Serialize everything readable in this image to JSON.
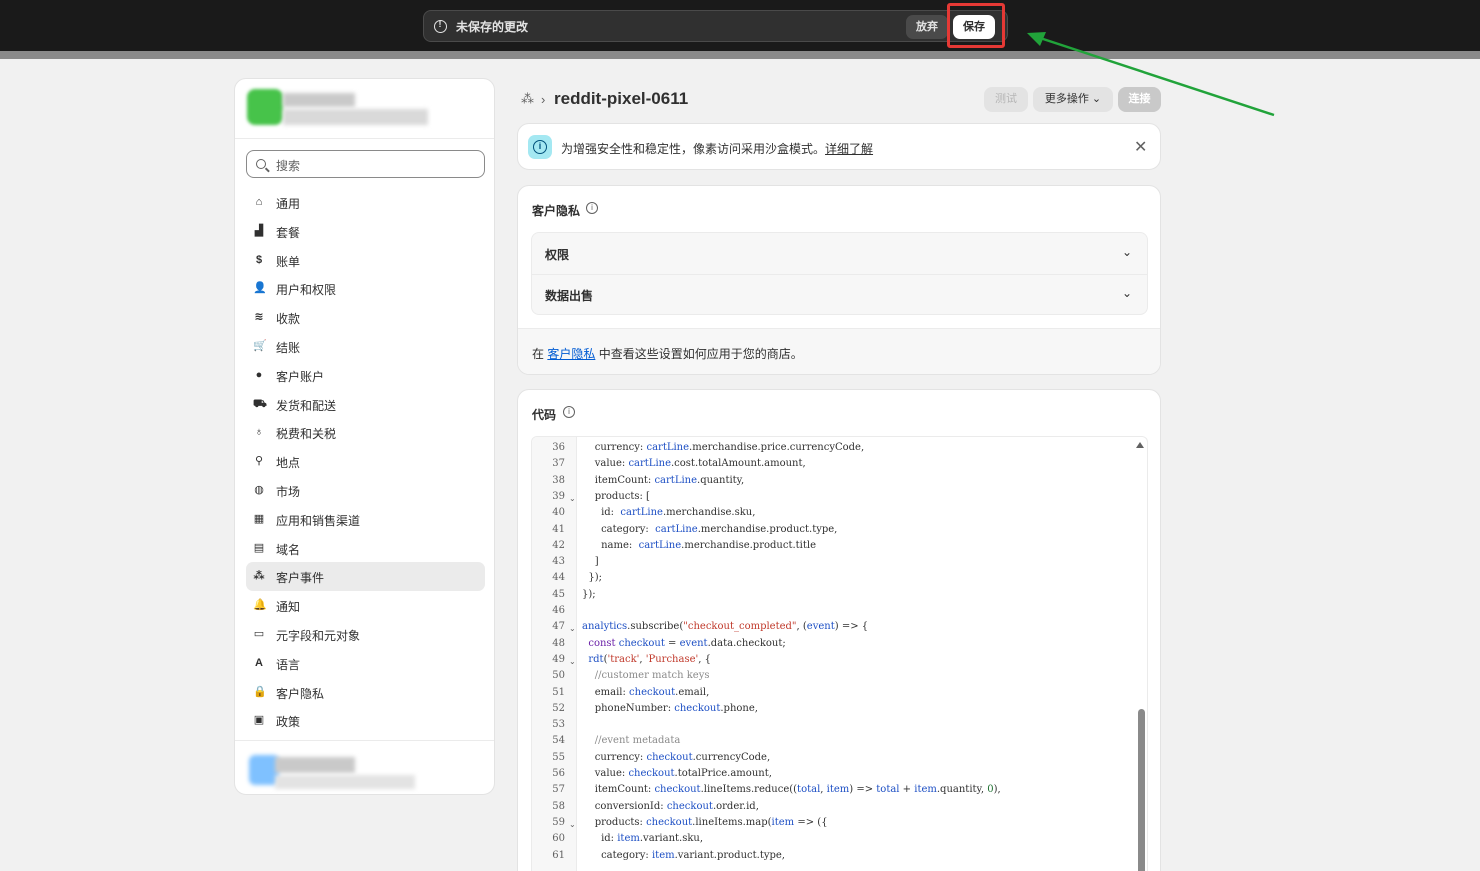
{
  "topbar": {
    "unsaved_text": "未保存的更改",
    "discard_label": "放弃",
    "save_label": "保存"
  },
  "sidebar": {
    "search_placeholder": "搜索",
    "items": [
      {
        "label": "通用",
        "icon": "store-icon",
        "glyph": "⌂"
      },
      {
        "label": "套餐",
        "icon": "chart-icon",
        "glyph": "▟"
      },
      {
        "label": "账单",
        "icon": "bill-icon",
        "glyph": "$"
      },
      {
        "label": "用户和权限",
        "icon": "users-icon",
        "glyph": "👤"
      },
      {
        "label": "收款",
        "icon": "payment-icon",
        "glyph": "≋"
      },
      {
        "label": "结账",
        "icon": "cart-icon",
        "glyph": "🛒"
      },
      {
        "label": "客户账户",
        "icon": "person-icon",
        "glyph": "●"
      },
      {
        "label": "发货和配送",
        "icon": "truck-icon",
        "glyph": "⛟"
      },
      {
        "label": "税费和关税",
        "icon": "tax-icon",
        "glyph": "♁"
      },
      {
        "label": "地点",
        "icon": "location-icon",
        "glyph": "⚲"
      },
      {
        "label": "市场",
        "icon": "globe-icon",
        "glyph": "◍"
      },
      {
        "label": "应用和销售渠道",
        "icon": "apps-icon",
        "glyph": "▦"
      },
      {
        "label": "域名",
        "icon": "domain-icon",
        "glyph": "▤"
      },
      {
        "label": "客户事件",
        "icon": "events-icon",
        "glyph": "⁂",
        "active": true
      },
      {
        "label": "通知",
        "icon": "bell-icon",
        "glyph": "🔔"
      },
      {
        "label": "元字段和元对象",
        "icon": "metafields-icon",
        "glyph": "▭"
      },
      {
        "label": "语言",
        "icon": "language-icon",
        "glyph": "A"
      },
      {
        "label": "客户隐私",
        "icon": "lock-icon",
        "glyph": "🔒"
      },
      {
        "label": "政策",
        "icon": "policy-icon",
        "glyph": "▣"
      }
    ]
  },
  "header": {
    "breadcrumb_icon": "events-icon",
    "title": "reddit-pixel-0611",
    "test_label": "测试",
    "more_label": "更多操作",
    "connect_label": "连接"
  },
  "banner": {
    "text": "为增强安全性和稳定性，像素访问采用沙盒模式。",
    "link": "详细了解"
  },
  "privacy": {
    "title": "客户隐私",
    "rows": [
      "权限",
      "数据出售"
    ],
    "footer_prefix": "在",
    "footer_link": "客户隐私",
    "footer_suffix": "中查看这些设置如何应用于您的商店。"
  },
  "code": {
    "title": "代码",
    "lines": [
      {
        "n": "36",
        "fold": false,
        "html": "    currency: <span class=\"tk-var\">cartLine</span>.merchandise.price.currencyCode,"
      },
      {
        "n": "37",
        "fold": false,
        "html": "    value: <span class=\"tk-var\">cartLine</span>.cost.totalAmount.amount,"
      },
      {
        "n": "38",
        "fold": false,
        "html": "    itemCount: <span class=\"tk-var\">cartLine</span>.quantity,"
      },
      {
        "n": "39",
        "fold": true,
        "html": "    products: ["
      },
      {
        "n": "40",
        "fold": false,
        "html": "      id:  <span class=\"tk-var\">cartLine</span>.merchandise.sku,"
      },
      {
        "n": "41",
        "fold": false,
        "html": "      category:  <span class=\"tk-var\">cartLine</span>.merchandise.product.type,"
      },
      {
        "n": "42",
        "fold": false,
        "html": "      name:  <span class=\"tk-var\">cartLine</span>.merchandise.product.title"
      },
      {
        "n": "43",
        "fold": false,
        "html": "    ]"
      },
      {
        "n": "44",
        "fold": false,
        "html": "  });"
      },
      {
        "n": "45",
        "fold": false,
        "html": "});"
      },
      {
        "n": "46",
        "fold": false,
        "html": ""
      },
      {
        "n": "47",
        "fold": true,
        "html": "<span class=\"tk-var\">analytics</span>.subscribe(<span class=\"tk-str\">\"checkout_completed\"</span>, (<span class=\"tk-var\">event</span>) => {"
      },
      {
        "n": "48",
        "fold": false,
        "html": "  <span class=\"tk-kw\">const</span> <span class=\"tk-var\">checkout</span> = <span class=\"tk-var\">event</span>.data.checkout;"
      },
      {
        "n": "49",
        "fold": true,
        "html": "  <span class=\"tk-var\">rdt</span>(<span class=\"tk-str\">'track'</span>, <span class=\"tk-str\">'Purchase'</span>, {"
      },
      {
        "n": "50",
        "fold": false,
        "html": "    <span class=\"tk-cmt\">//customer match keys</span>"
      },
      {
        "n": "51",
        "fold": false,
        "html": "    email: <span class=\"tk-var\">checkout</span>.email,"
      },
      {
        "n": "52",
        "fold": false,
        "html": "    phoneNumber: <span class=\"tk-var\">checkout</span>.phone,"
      },
      {
        "n": "53",
        "fold": false,
        "html": ""
      },
      {
        "n": "54",
        "fold": false,
        "html": "    <span class=\"tk-cmt\">//event metadata</span>"
      },
      {
        "n": "55",
        "fold": false,
        "html": "    currency: <span class=\"tk-var\">checkout</span>.currencyCode,"
      },
      {
        "n": "56",
        "fold": false,
        "html": "    value: <span class=\"tk-var\">checkout</span>.totalPrice.amount,"
      },
      {
        "n": "57",
        "fold": false,
        "html": "    itemCount: <span class=\"tk-var\">checkout</span>.lineItems.reduce((<span class=\"tk-var\">total</span>, <span class=\"tk-var\">item</span>) => <span class=\"tk-var\">total</span> + <span class=\"tk-var\">item</span>.quantity, <span class=\"tk-num\">0</span>),"
      },
      {
        "n": "58",
        "fold": false,
        "html": "    conversionId: <span class=\"tk-var\">checkout</span>.order.id,"
      },
      {
        "n": "59",
        "fold": true,
        "html": "    products: <span class=\"tk-var\">checkout</span>.lineItems.map(<span class=\"tk-var\">item</span> => ({"
      },
      {
        "n": "60",
        "fold": false,
        "html": "      id: <span class=\"tk-var\">item</span>.variant.sku,"
      },
      {
        "n": "61",
        "fold": false,
        "html": "      category: <span class=\"tk-var\">item</span>.variant.product.type,"
      }
    ]
  },
  "colors": {
    "topbar_bg": "#1a1a1a",
    "highlight": "#e53935",
    "arrow": "#21a33a",
    "link": "#005bd3"
  }
}
